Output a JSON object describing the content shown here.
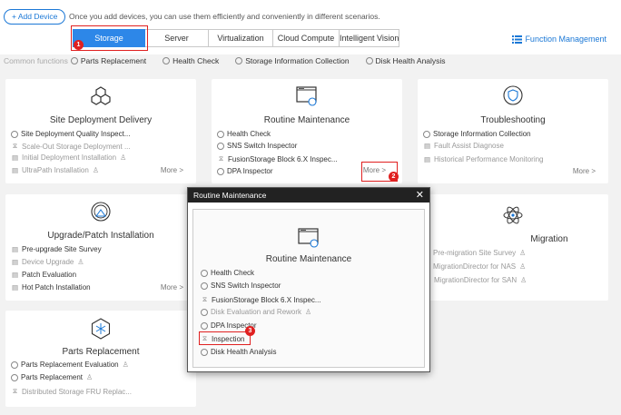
{
  "header": {
    "add_device": "+ Add Device",
    "hint": "Once you add devices, you can use them efficiently and conveniently in different scenarios.",
    "function_management": "Function Management"
  },
  "tabs": [
    {
      "label": "Storage",
      "active": true
    },
    {
      "label": "Server"
    },
    {
      "label": "Virtualization"
    },
    {
      "label": "Cloud Compute"
    },
    {
      "label": "Intelligent Vision"
    }
  ],
  "common_functions": {
    "label": "Common functions",
    "items": [
      "Parts Replacement",
      "Health Check",
      "Storage Information Collection",
      "Disk Health Analysis"
    ]
  },
  "cards": {
    "site_deployment": {
      "title": "Site Deployment Delivery",
      "items": [
        "Site Deployment Quality Inspect...",
        "Scale-Out Storage Deployment ...",
        "Initial Deployment Installation",
        "UltraPath Installation"
      ],
      "more": "More >"
    },
    "routine": {
      "title": "Routine Maintenance",
      "items": [
        "Health Check",
        "SNS Switch Inspector",
        "FusionStorage Block 6.X Inspec...",
        "DPA Inspector"
      ],
      "more": "More >"
    },
    "troubleshooting": {
      "title": "Troubleshooting",
      "items": [
        "Storage Information Collection",
        "Fault Assist Diagnose",
        "Historical Performance Monitoring"
      ],
      "more": "More >"
    },
    "upgrade": {
      "title": "Upgrade/Patch Installation",
      "items": [
        "Pre-upgrade Site Survey",
        "Device Upgrade",
        "Patch Evaluation",
        "Hot Patch Installation"
      ],
      "more": "More >"
    },
    "migration": {
      "title": "Migration",
      "items": [
        "Pre-migration Site Survey",
        "MigrationDirector for NAS",
        "MigrationDirector for SAN"
      ]
    },
    "parts": {
      "title": "Parts Replacement",
      "items": [
        "Parts Replacement Evaluation",
        "Parts Replacement",
        "Distributed Storage FRU Replac..."
      ]
    }
  },
  "modal": {
    "title": "Routine Maintenance",
    "card_title": "Routine Maintenance",
    "items": [
      "Health Check",
      "SNS Switch Inspector",
      "FusionStorage Block 6.X Inspec...",
      "Disk Evaluation and Rework",
      "DPA Inspector",
      "Inspection",
      "Disk Health Analysis"
    ]
  },
  "badges": [
    "1",
    "2",
    "3"
  ],
  "colors": {
    "accent": "#2d87e8",
    "highlight": "#e02020"
  }
}
